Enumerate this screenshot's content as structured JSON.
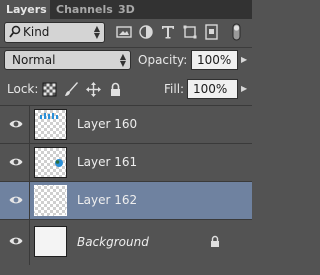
{
  "tabs": [
    {
      "label": "Layers",
      "active": true
    },
    {
      "label": "Channels",
      "active": false
    },
    {
      "label": "3D",
      "active": false
    }
  ],
  "filter": {
    "kind_label": "Kind",
    "icons": [
      "image-filter-icon",
      "adjustment-filter-icon",
      "type-filter-icon",
      "shape-filter-icon",
      "smart-object-filter-icon"
    ]
  },
  "blend": {
    "mode": "Normal"
  },
  "opacity": {
    "label": "Opacity:",
    "value": "100%"
  },
  "lock": {
    "label": "Lock:",
    "icons": [
      "lock-transparent-icon",
      "lock-image-icon",
      "lock-position-icon",
      "lock-all-icon"
    ]
  },
  "fill": {
    "label": "Fill:",
    "value": "100%"
  },
  "layers": [
    {
      "name": "Layer 160",
      "visible": true,
      "selected": false,
      "italic": false,
      "locked": false
    },
    {
      "name": "Layer 161",
      "visible": true,
      "selected": false,
      "italic": false,
      "locked": false
    },
    {
      "name": "Layer 162",
      "visible": true,
      "selected": true,
      "italic": false,
      "locked": false
    },
    {
      "name": "Background",
      "visible": true,
      "selected": false,
      "italic": true,
      "locked": true
    }
  ],
  "colors": {
    "selected_row": "#6f82a0",
    "panel": "#535353",
    "tab_bar": "#323232"
  }
}
